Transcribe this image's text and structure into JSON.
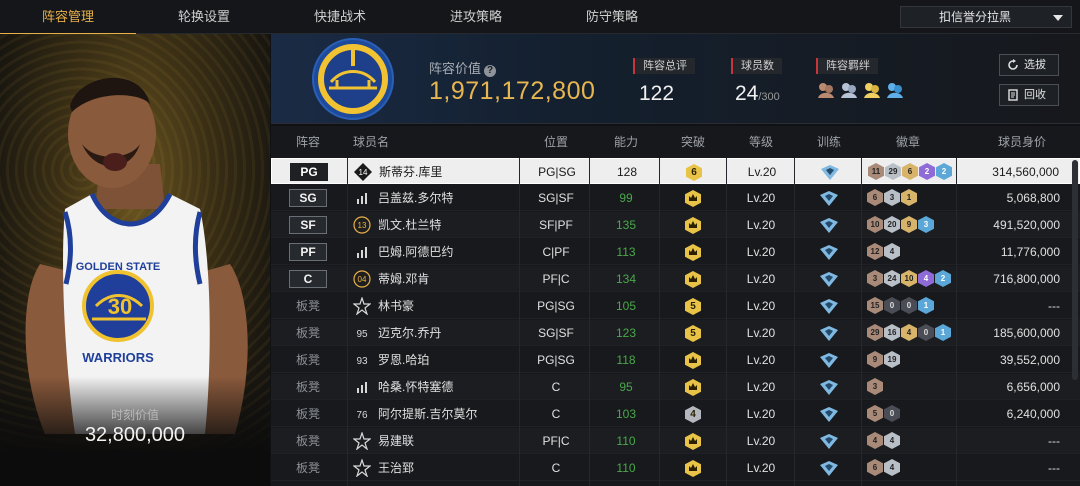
{
  "nav": {
    "tabs": [
      "阵容管理",
      "轮换设置",
      "快捷战术",
      "进攻策略",
      "防守策略"
    ],
    "active_tab": 0,
    "dropdown_label": "扣信誉分拉黑"
  },
  "player_panel": {
    "jersey_team": "GOLDEN STATE",
    "jersey_name": "WARRIORS",
    "jersey_number": "30",
    "moment_label": "时刻价值",
    "moment_value": "32,800,000"
  },
  "header": {
    "value_label": "阵容价值",
    "value_number": "1,971,172,800",
    "rating_label": "阵容总评",
    "rating_value": "122",
    "players_label": "球员数",
    "players_value": "24",
    "players_max": "/300",
    "bonds_label": "阵容羁绊",
    "select_button": "选拔",
    "recycle_button": "回收"
  },
  "table": {
    "headers": [
      "阵容",
      "球员名",
      "位置",
      "能力",
      "突破",
      "等级",
      "训练",
      "徽章",
      "球员身价"
    ],
    "rows": [
      {
        "slot": "PG",
        "starter": true,
        "jersey": "14",
        "name": "斯蒂芬.库里",
        "position": "PG|SG",
        "ability": "128",
        "breakthrough": "6",
        "level": "Lv.20",
        "badges": [
          [
            "b-bronze",
            "11"
          ],
          [
            "b-silver",
            "29"
          ],
          [
            "b-gold",
            "6"
          ],
          [
            "b-purple",
            "2"
          ],
          [
            "b-blue",
            "2"
          ]
        ],
        "salary": "314,560,000",
        "selected": true
      },
      {
        "slot": "SG",
        "starter": true,
        "jersey": "bars",
        "name": "吕盖兹.多尔特",
        "position": "SG|SF",
        "ability": "99",
        "breakthrough": "crown",
        "level": "Lv.20",
        "badges": [
          [
            "b-bronze",
            "6"
          ],
          [
            "b-silver",
            "3"
          ],
          [
            "b-gold",
            "1"
          ]
        ],
        "salary": "5,068,800"
      },
      {
        "slot": "SF",
        "starter": true,
        "jersey": "13",
        "name": "凯文.杜兰特",
        "position": "SF|PF",
        "ability": "135",
        "breakthrough": "crown",
        "level": "Lv.20",
        "badges": [
          [
            "b-bronze",
            "10"
          ],
          [
            "b-silver",
            "20"
          ],
          [
            "b-gold",
            "9"
          ],
          [
            "b-blue",
            "3"
          ]
        ],
        "salary": "491,520,000"
      },
      {
        "slot": "PF",
        "starter": true,
        "jersey": "bars",
        "name": "巴姆.阿德巴约",
        "position": "C|PF",
        "ability": "113",
        "breakthrough": "crown",
        "level": "Lv.20",
        "badges": [
          [
            "b-bronze",
            "12"
          ],
          [
            "b-silver",
            "4"
          ]
        ],
        "salary": "11,776,000"
      },
      {
        "slot": "C",
        "starter": true,
        "jersey": "04",
        "name": "蒂姆.邓肯",
        "position": "PF|C",
        "ability": "134",
        "breakthrough": "crown",
        "level": "Lv.20",
        "badges": [
          [
            "b-bronze",
            "3"
          ],
          [
            "b-silver",
            "24"
          ],
          [
            "b-gold",
            "10"
          ],
          [
            "b-purple",
            "4"
          ],
          [
            "b-blue",
            "2"
          ]
        ],
        "salary": "716,800,000"
      },
      {
        "slot": "板凳",
        "starter": false,
        "jersey": "star",
        "name": "林书豪",
        "position": "PG|SG",
        "ability": "105",
        "breakthrough": "5",
        "level": "Lv.20",
        "badges": [
          [
            "b-bronze",
            "15"
          ],
          [
            "b-dark",
            "0"
          ],
          [
            "b-dark",
            "0"
          ],
          [
            "b-blue",
            "1"
          ]
        ],
        "salary": "---"
      },
      {
        "slot": "板凳",
        "starter": false,
        "jersey": "95",
        "name": "迈克尔.乔丹",
        "position": "SG|SF",
        "ability": "123",
        "breakthrough": "5",
        "level": "Lv.20",
        "badges": [
          [
            "b-bronze",
            "29"
          ],
          [
            "b-silver",
            "16"
          ],
          [
            "b-gold",
            "4"
          ],
          [
            "b-dark",
            "0"
          ],
          [
            "b-blue",
            "1"
          ]
        ],
        "salary": "185,600,000"
      },
      {
        "slot": "板凳",
        "starter": false,
        "jersey": "93",
        "name": "罗恩.哈珀",
        "position": "PG|SG",
        "ability": "118",
        "breakthrough": "crown",
        "level": "Lv.20",
        "badges": [
          [
            "b-bronze",
            "9"
          ],
          [
            "b-silver",
            "19"
          ]
        ],
        "salary": "39,552,000"
      },
      {
        "slot": "板凳",
        "starter": false,
        "jersey": "bars",
        "name": "哈桑.怀特塞德",
        "position": "C",
        "ability": "95",
        "breakthrough": "crown",
        "level": "Lv.20",
        "badges": [
          [
            "b-bronze",
            "3"
          ]
        ],
        "salary": "6,656,000"
      },
      {
        "slot": "板凳",
        "starter": false,
        "jersey": "76",
        "name": "阿尔提斯.吉尔莫尔",
        "position": "C",
        "ability": "103",
        "breakthrough": "4",
        "level": "Lv.20",
        "badges": [
          [
            "b-bronze",
            "5"
          ],
          [
            "b-dark",
            "0"
          ]
        ],
        "salary": "6,240,000"
      },
      {
        "slot": "板凳",
        "starter": false,
        "jersey": "star",
        "name": "易建联",
        "position": "PF|C",
        "ability": "110",
        "breakthrough": "crown",
        "level": "Lv.20",
        "badges": [
          [
            "b-bronze",
            "4"
          ],
          [
            "b-silver",
            "4"
          ]
        ],
        "salary": "---"
      },
      {
        "slot": "板凳",
        "starter": false,
        "jersey": "star",
        "name": "王治郅",
        "position": "C",
        "ability": "110",
        "breakthrough": "crown",
        "level": "Lv.20",
        "badges": [
          [
            "b-bronze",
            "6"
          ],
          [
            "b-silver",
            "4"
          ]
        ],
        "salary": "---"
      }
    ]
  },
  "colors": {
    "accent": "#e8b04a",
    "value_gold": "#e7b651",
    "ability_green": "#4aa84a",
    "breakthrough_gold": "#e8c347",
    "breakthrough_gray": "#b4b8be",
    "training_blue": "#7fb8e0"
  }
}
